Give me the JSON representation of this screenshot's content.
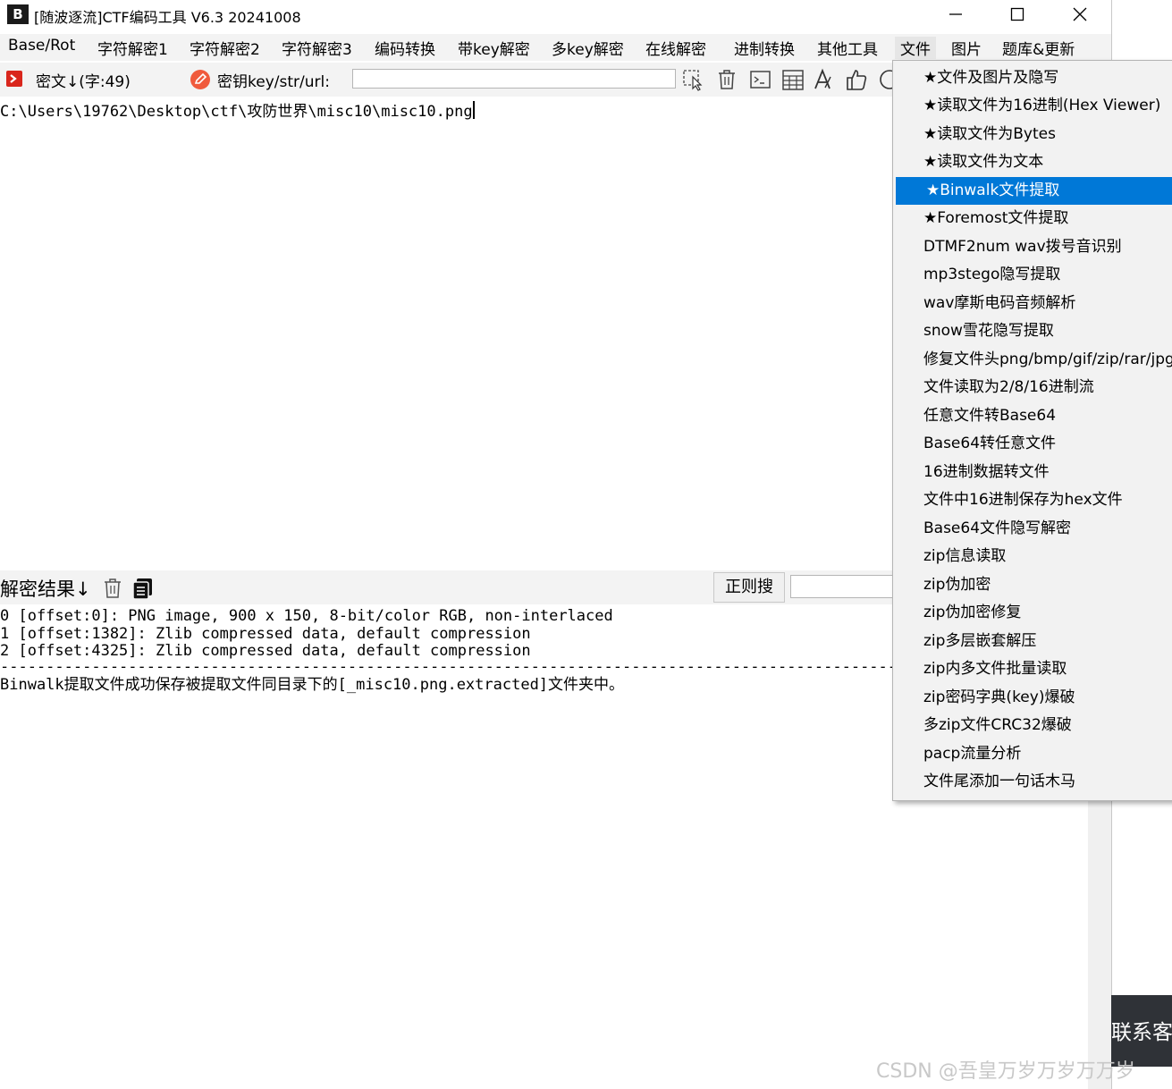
{
  "window": {
    "logo_text": "B",
    "title": "[随波逐流]CTF编码工具 V6.3 20241008"
  },
  "menu": [
    "Base/Rot",
    "字符解密1",
    "字符解密2",
    "字符解密3",
    "编码转换",
    "带key解密",
    "多key解密",
    "在线解密",
    "进制转换",
    "其他工具",
    "文件",
    "图片",
    "题库&更新"
  ],
  "toolbar": {
    "cipher_label": "密文↓(字:49)",
    "key_label": "密钥key/str/url:",
    "key_value": ""
  },
  "input": {
    "text": "C:\\Users\\19762\\Desktop\\ctf\\攻防世界\\misc10\\misc10.png"
  },
  "result": {
    "label": "解密结果↓",
    "regex_button": "正则搜",
    "regex_value": "",
    "lines": [
      "0 [offset:0]: PNG image, 900 x 150, 8-bit/color RGB, non-interlaced",
      "1 [offset:1382]: Zlib compressed data, default compression",
      "2 [offset:4325]: Zlib compressed data, default compression",
      "--------------------------------------------------------------------------------------------------------------------------------",
      "Binwalk提取文件成功保存被提取文件同目录下的[_misc10.png.extracted]文件夹中。"
    ]
  },
  "file_menu": {
    "selected_index": 4,
    "items": [
      "★文件及图片及隐写",
      "★读取文件为16进制(Hex Viewer)",
      "★读取文件为Bytes",
      "★读取文件为文本",
      "★Binwalk文件提取",
      "★Foremost文件提取",
      "DTMF2num  wav拨号音识别",
      "mp3stego隐写提取",
      "wav摩斯电码音频解析",
      "snow雪花隐写提取",
      "修复文件头png/bmp/gif/zip/rar/jpg",
      "文件读取为2/8/16进制流",
      "任意文件转Base64",
      "Base64转任意文件",
      "16进制数据转文件",
      "文件中16进制保存为hex文件",
      "Base64文件隐写解密",
      "zip信息读取",
      "zip伪加密",
      "zip伪加密修复",
      "zip多层嵌套解压",
      "zip内多文件批量读取",
      "zip密码字典(key)爆破",
      "多zip文件CRC32爆破",
      "pacp流量分析",
      "文件尾添加一句话木马"
    ]
  },
  "overlay": {
    "contact_text": "联系客",
    "watermark": "CSDN @吾皇万岁万岁万万岁"
  },
  "colors": {
    "selection": "#0078d7",
    "toolbar_bg": "#f3f3f3",
    "menu_bg": "#f2f2f2",
    "contact_bg": "#2f3237"
  }
}
